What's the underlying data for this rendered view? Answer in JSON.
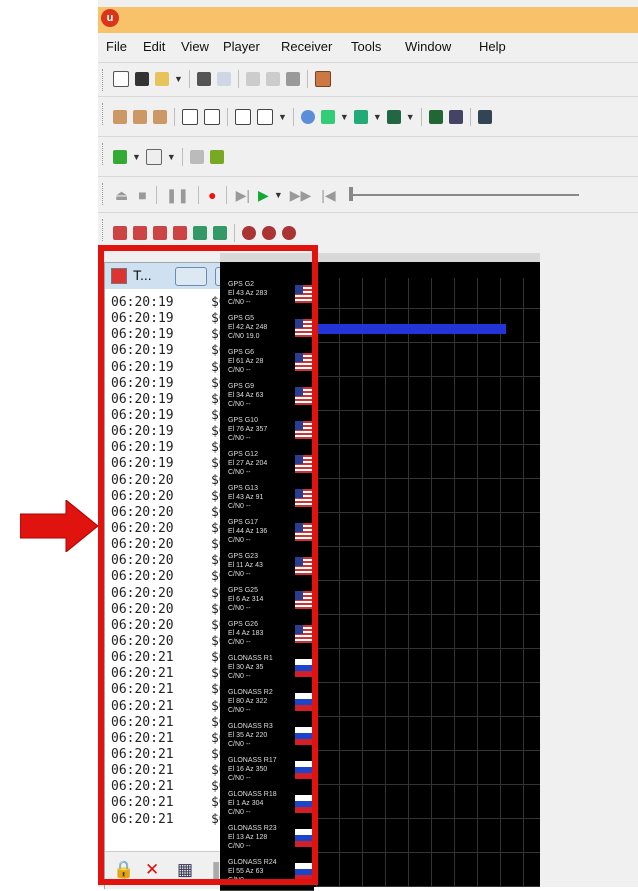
{
  "menu": [
    "File",
    "Edit",
    "View",
    "Player",
    "Receiver",
    "Tools",
    "Window",
    "Help"
  ],
  "console": {
    "title": "T...",
    "rows": [
      {
        "time": "06:20:19",
        "msg": "$GNRMC"
      },
      {
        "time": "06:20:19",
        "msg": "$GNVTG"
      },
      {
        "time": "06:20:19",
        "msg": "$GNGGA"
      },
      {
        "time": "06:20:19",
        "msg": "$GNGSA"
      },
      {
        "time": "06:20:19",
        "msg": "$GNGSA"
      },
      {
        "time": "06:20:19",
        "msg": "$GPGSV"
      },
      {
        "time": "06:20:19",
        "msg": "$GPGSV"
      },
      {
        "time": "06:20:19",
        "msg": "$GPGSV"
      },
      {
        "time": "06:20:19",
        "msg": "$GLGSV"
      },
      {
        "time": "06:20:19",
        "msg": "$GLGSV"
      },
      {
        "time": "06:20:19",
        "msg": "$GNGLL"
      },
      {
        "time": "06:20:20",
        "msg": "$GNRMC"
      },
      {
        "time": "06:20:20",
        "msg": "$GNVTG"
      },
      {
        "time": "06:20:20",
        "msg": "$GNGGA"
      },
      {
        "time": "06:20:20",
        "msg": "$GNGSA"
      },
      {
        "time": "06:20:20",
        "msg": "$GNGSA"
      },
      {
        "time": "06:20:20",
        "msg": "$GPGSV"
      },
      {
        "time": "06:20:20",
        "msg": "$GPGSV"
      },
      {
        "time": "06:20:20",
        "msg": "$GPGSV"
      },
      {
        "time": "06:20:20",
        "msg": "$GLGSV"
      },
      {
        "time": "06:20:20",
        "msg": "$GLGSV"
      },
      {
        "time": "06:20:20",
        "msg": "$GNGLL"
      },
      {
        "time": "06:20:21",
        "msg": "$GNRMC"
      },
      {
        "time": "06:20:21",
        "msg": "$GNVTG"
      },
      {
        "time": "06:20:21",
        "msg": "$GNGGA"
      },
      {
        "time": "06:20:21",
        "msg": "$GNGSA"
      },
      {
        "time": "06:20:21",
        "msg": "$GNGSA"
      },
      {
        "time": "06:20:21",
        "msg": "$GPGSV"
      },
      {
        "time": "06:20:21",
        "msg": "$GPGSV"
      },
      {
        "time": "06:20:21",
        "msg": "$GPGSV"
      },
      {
        "time": "06:20:21",
        "msg": "$GLGSV"
      },
      {
        "time": "06:20:21",
        "msg": "$GLGSV"
      },
      {
        "time": "06:20:21",
        "msg": "$GNGLL"
      }
    ]
  },
  "satellites": [
    {
      "name": "GPS G2",
      "elaz": "El 43 Az 283",
      "cno": "C/N0 --",
      "flag": "us"
    },
    {
      "name": "GPS G5",
      "elaz": "El 42 Az 248",
      "cno": "C/N0 19.0",
      "flag": "us",
      "cno_level": 0.85
    },
    {
      "name": "GPS G6",
      "elaz": "El 61 Az 28",
      "cno": "C/N0 --",
      "flag": "us"
    },
    {
      "name": "GPS G9",
      "elaz": "El 34 Az 63",
      "cno": "C/N0 --",
      "flag": "us"
    },
    {
      "name": "GPS G10",
      "elaz": "El 76 Az 357",
      "cno": "C/N0 --",
      "flag": "us"
    },
    {
      "name": "GPS G12",
      "elaz": "El 27 Az 204",
      "cno": "C/N0 --",
      "flag": "us"
    },
    {
      "name": "GPS G13",
      "elaz": "El 43 Az 91",
      "cno": "C/N0 --",
      "flag": "us"
    },
    {
      "name": "GPS G17",
      "elaz": "El 44 Az 136",
      "cno": "C/N0 --",
      "flag": "us"
    },
    {
      "name": "GPS G23",
      "elaz": "El 11 Az 43",
      "cno": "C/N0 --",
      "flag": "us"
    },
    {
      "name": "GPS G25",
      "elaz": "El 6 Az 314",
      "cno": "C/N0 --",
      "flag": "us"
    },
    {
      "name": "GPS G26",
      "elaz": "El 4 Az 183",
      "cno": "C/N0 --",
      "flag": "us"
    },
    {
      "name": "GLONASS R1",
      "elaz": "El 30 Az 35",
      "cno": "C/N0 --",
      "flag": "ru"
    },
    {
      "name": "GLONASS R2",
      "elaz": "El 80 Az 322",
      "cno": "C/N0 --",
      "flag": "ru"
    },
    {
      "name": "GLONASS R3",
      "elaz": "El 35 Az 220",
      "cno": "C/N0 --",
      "flag": "ru"
    },
    {
      "name": "GLONASS R17",
      "elaz": "El 16 Az 350",
      "cno": "C/N0 --",
      "flag": "ru"
    },
    {
      "name": "GLONASS R18",
      "elaz": "El 1 Az 304",
      "cno": "C/N0 --",
      "flag": "ru"
    },
    {
      "name": "GLONASS R23",
      "elaz": "El 13 Az 128",
      "cno": "C/N0 --",
      "flag": "ru"
    },
    {
      "name": "GLONASS R24",
      "elaz": "El 55 Az 63",
      "cno": "C/N0 --",
      "flag": "ru"
    }
  ],
  "colors": {
    "highlight": "#e0130e",
    "cno_bar": "#2335d6",
    "titlebar": "#f8c26a"
  }
}
